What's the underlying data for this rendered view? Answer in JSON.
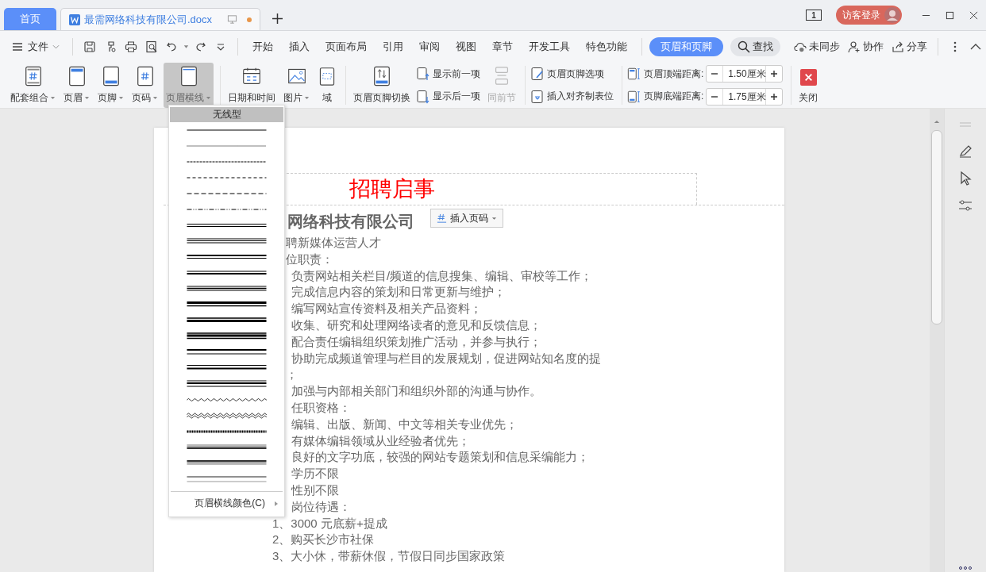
{
  "tabs": [
    {
      "label": "首页",
      "kind": "home",
      "selected": false
    },
    {
      "label": "最需网络科技有限公司.docx",
      "kind": "doc",
      "selected": true,
      "unsaved": true
    }
  ],
  "title_bar": {
    "page_count": "1",
    "login": "访客登录"
  },
  "menu": {
    "file": "文件",
    "tabs": [
      {
        "label": "开始",
        "selected": false
      },
      {
        "label": "插入",
        "selected": false
      },
      {
        "label": "页面布局",
        "selected": false
      },
      {
        "label": "引用",
        "selected": false
      },
      {
        "label": "审阅",
        "selected": false
      },
      {
        "label": "视图",
        "selected": false
      },
      {
        "label": "章节",
        "selected": false
      },
      {
        "label": "开发工具",
        "selected": false
      },
      {
        "label": "特色功能",
        "selected": false
      },
      {
        "label": "页眉和页脚",
        "selected": true
      }
    ],
    "search": "查找",
    "sync": "未同步",
    "collab": "协作",
    "share": "分享"
  },
  "ribbon": {
    "insert_buttons": [
      {
        "label": "配套组合",
        "dropdown": true,
        "pressed": false
      },
      {
        "label": "页眉",
        "dropdown": true,
        "pressed": false
      },
      {
        "label": "页脚",
        "dropdown": true,
        "pressed": false
      },
      {
        "label": "页码",
        "dropdown": true,
        "pressed": false
      },
      {
        "label": "页眉横线",
        "dropdown": true,
        "pressed": true
      }
    ],
    "media_buttons": [
      {
        "label": "日期和时间",
        "dropdown": false
      },
      {
        "label": "图片",
        "dropdown": true
      },
      {
        "label": "域",
        "dropdown": false
      }
    ],
    "switch_button": "页眉页脚切换",
    "nav_buttons": [
      "显示前一项",
      "显示后一项"
    ],
    "same_as_previous": {
      "label": "同前节",
      "disabled": true
    },
    "option_buttons": [
      "页眉页脚选项",
      "插入对齐制表位"
    ],
    "distances": [
      {
        "label": "页眉顶端距离:",
        "value": "1.50厘米"
      },
      {
        "label": "页脚底端距离:",
        "value": "1.75厘米"
      }
    ],
    "close": "关闭"
  },
  "line_menu": {
    "none_label": "无线型",
    "color_item": "页眉横线颜色(C)",
    "styles": [
      {
        "kind": "single"
      },
      {
        "kind": "dotted"
      },
      {
        "kind": "dashsmall"
      },
      {
        "kind": "dash"
      },
      {
        "kind": "dashlong"
      },
      {
        "kind": "dashdotdot"
      },
      {
        "kind": "double"
      },
      {
        "kind": "triple"
      },
      {
        "kind": "thickthin"
      },
      {
        "kind": "thinthick"
      },
      {
        "kind": "thinthickthin"
      },
      {
        "kind": "thickthinlarge"
      },
      {
        "kind": "thinthicklarge"
      },
      {
        "kind": "thinthickthinlarge"
      },
      {
        "kind": "thickthinwide"
      },
      {
        "kind": "thinthickwide"
      },
      {
        "kind": "thinthickthinwide"
      },
      {
        "kind": "wave"
      },
      {
        "kind": "doublewave"
      },
      {
        "kind": "hatched"
      },
      {
        "kind": "emboss"
      },
      {
        "kind": "engrave"
      },
      {
        "kind": "outset"
      }
    ]
  },
  "document": {
    "header_title": "招聘启事",
    "page_number_button": "插入页码",
    "lines": [
      {
        "kind": "heading",
        "text": "网络科技有限公司"
      },
      {
        "kind": "cut",
        "text": "聘新媒体运营人才"
      },
      {
        "kind": "cut",
        "text": "位职责："
      },
      {
        "kind": "indent",
        "text": "负责网站相关栏目/频道的信息搜集、编辑、审校等工作；"
      },
      {
        "kind": "indent",
        "text": "完成信息内容的策划和日常更新与维护；"
      },
      {
        "kind": "indent",
        "text": "编写网站宣传资料及相关产品资料；"
      },
      {
        "kind": "indent",
        "text": "收集、研究和处理网络读者的意见和反馈信息；"
      },
      {
        "kind": "indent",
        "text": "配合责任编辑组织策划推广活动，并参与执行；"
      },
      {
        "kind": "indent",
        "text": "协助完成频道管理与栏目的发展规划，促进网站知名度的提"
      },
      {
        "kind": "cut",
        "text": "；"
      },
      {
        "kind": "indent",
        "text": "加强与内部相关部门和组织外部的沟通与协作。"
      },
      {
        "kind": "indent",
        "text": "任职资格："
      },
      {
        "kind": "indent",
        "text": "编辑、出版、新闻、中文等相关专业优先；"
      },
      {
        "kind": "indent",
        "text": "有媒体编辑领域从业经验者优先；"
      },
      {
        "kind": "indent",
        "text": "良好的文字功底，较强的网站专题策划和信息采编能力；"
      },
      {
        "kind": "indent",
        "text": "学历不限"
      },
      {
        "kind": "indent",
        "text": "性别不限"
      },
      {
        "kind": "indent",
        "text": "岗位待遇："
      },
      {
        "kind": "numbered",
        "text": "1、3000 元底薪+提成"
      },
      {
        "kind": "numbered",
        "text": "2、购买长沙市社保"
      },
      {
        "kind": "numbered",
        "text": "3、大小休，带薪休假，节假日同步国家政策"
      }
    ]
  }
}
